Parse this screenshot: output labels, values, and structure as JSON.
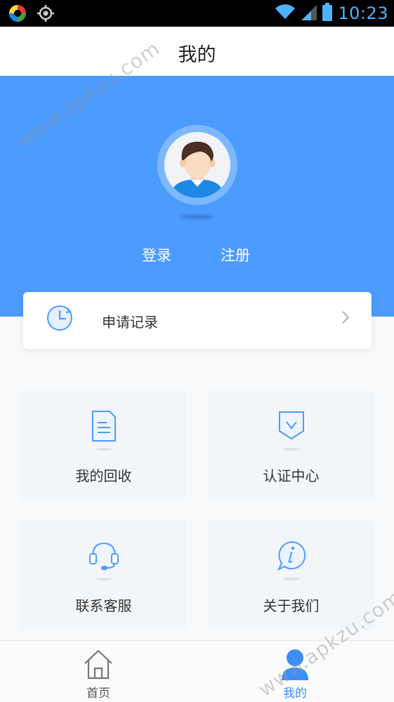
{
  "status_bar": {
    "time": "10:23"
  },
  "header": {
    "title": "我的"
  },
  "profile": {
    "login_label": "登录",
    "register_label": "注册"
  },
  "record": {
    "label": "申请记录"
  },
  "grid": [
    {
      "label": "我的回收",
      "icon": "document-icon"
    },
    {
      "label": "认证中心",
      "icon": "shield-check-icon"
    },
    {
      "label": "联系客服",
      "icon": "headset-icon"
    },
    {
      "label": "关于我们",
      "icon": "info-bubble-icon"
    }
  ],
  "bottom_nav": [
    {
      "label": "首页",
      "icon": "home-icon"
    },
    {
      "label": "我的",
      "icon": "person-icon",
      "active": true
    }
  ],
  "watermark": {
    "text": "www.apkzu.com"
  },
  "colors": {
    "accent": "#4c9bff",
    "active_tab": "#3e8ef7"
  }
}
